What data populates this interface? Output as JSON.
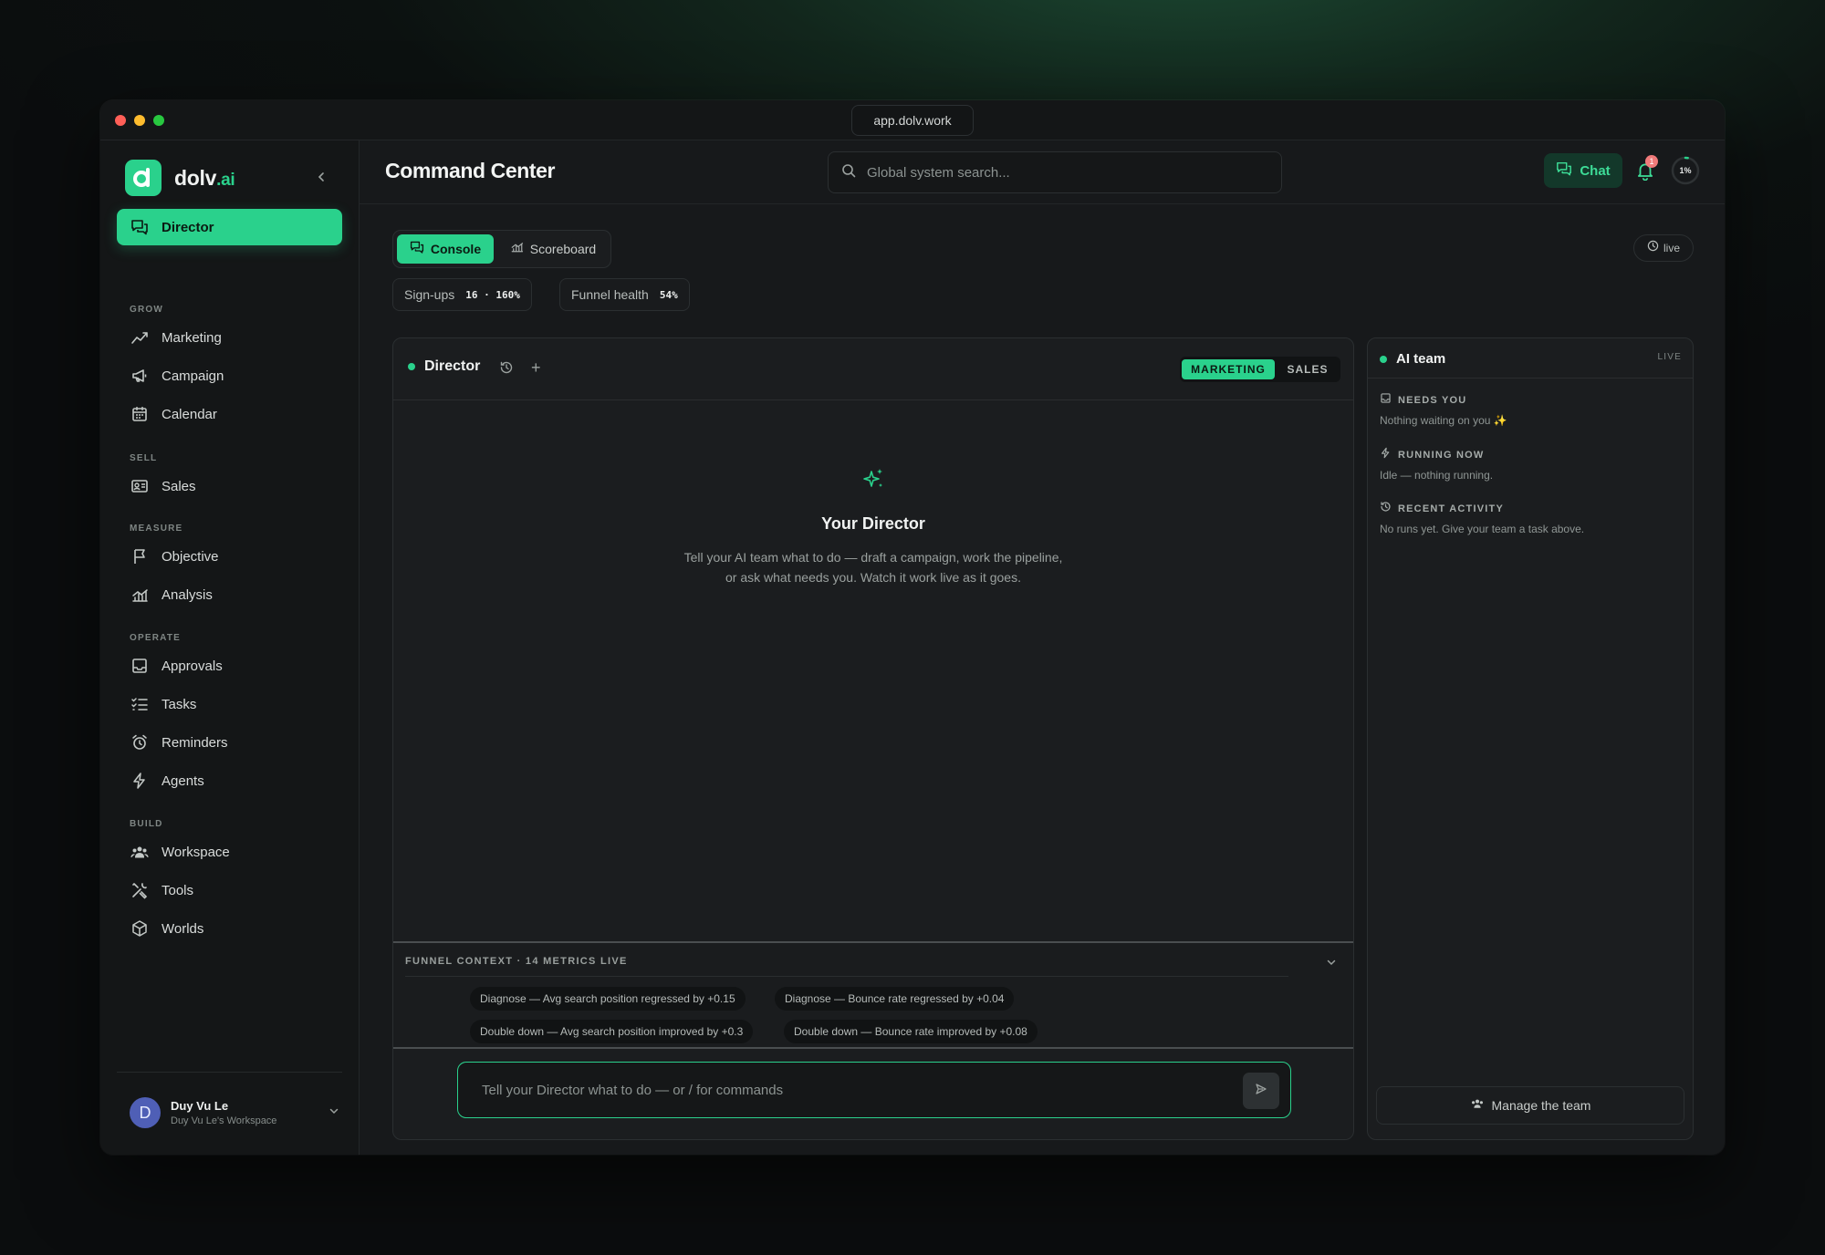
{
  "browser": {
    "url": "app.dolv.work"
  },
  "brand": {
    "name": "dolv",
    "suffix": ".ai",
    "accent": "#2ad18c"
  },
  "sidebar": {
    "active": {
      "label": "Director",
      "icon": "chat-bubbles-icon"
    },
    "sections": [
      {
        "label": "GROW",
        "items": [
          {
            "label": "Marketing",
            "icon": "trend-line-icon"
          },
          {
            "label": "Campaign",
            "icon": "megaphone-icon"
          },
          {
            "label": "Calendar",
            "icon": "calendar-icon"
          }
        ]
      },
      {
        "label": "SELL",
        "items": [
          {
            "label": "Sales",
            "icon": "contact-card-icon"
          }
        ]
      },
      {
        "label": "MEASURE",
        "items": [
          {
            "label": "Objective",
            "icon": "flag-icon"
          },
          {
            "label": "Analysis",
            "icon": "bar-chart-icon"
          }
        ]
      },
      {
        "label": "OPERATE",
        "items": [
          {
            "label": "Approvals",
            "icon": "inbox-icon"
          },
          {
            "label": "Tasks",
            "icon": "checklist-icon"
          },
          {
            "label": "Reminders",
            "icon": "alarm-clock-icon"
          },
          {
            "label": "Agents",
            "icon": "lightning-icon"
          }
        ]
      },
      {
        "label": "BUILD",
        "items": [
          {
            "label": "Workspace",
            "icon": "team-icon"
          },
          {
            "label": "Tools",
            "icon": "tools-icon"
          },
          {
            "label": "Worlds",
            "icon": "cube-icon"
          }
        ]
      }
    ],
    "user": {
      "initial": "D",
      "name": "Duy Vu Le",
      "workspace": "Duy Vu Le's Workspace"
    }
  },
  "header": {
    "title": "Command Center",
    "search_placeholder": "Global system search...",
    "chat_label": "Chat",
    "notification_count": "1",
    "progress_label": "1%",
    "progress_fraction": 0.01
  },
  "main": {
    "tabs": [
      {
        "label": "Console",
        "active": true
      },
      {
        "label": "Scoreboard",
        "active": false
      }
    ],
    "live_label": "live",
    "metrics": [
      {
        "label": "Sign-ups",
        "value": "16 · 160%"
      },
      {
        "label": "Funnel health",
        "value": "54%"
      }
    ]
  },
  "director": {
    "title": "Director",
    "modes": [
      {
        "label": "MARKETING",
        "active": true
      },
      {
        "label": "SALES",
        "active": false
      }
    ],
    "empty_title": "Your Director",
    "empty_text": "Tell your AI team what to do — draft a campaign, work the pipeline, or ask what needs you. Watch it work live as it goes.",
    "funnel": {
      "label": "FUNNEL CONTEXT · 14 METRICS LIVE",
      "chips": [
        "Diagnose — Avg search position regressed by +0.15",
        "Diagnose — Bounce rate regressed by +0.04",
        "Double down — Avg search position improved by +0.3",
        "Double down — Bounce rate improved by +0.08"
      ]
    },
    "composer_placeholder": "Tell your Director what to do — or / for commands"
  },
  "ai_team": {
    "title": "AI team",
    "live_label": "LIVE",
    "sections": [
      {
        "label": "NEEDS YOU",
        "text": "Nothing waiting on you ✨",
        "icon": "inbox-icon"
      },
      {
        "label": "RUNNING NOW",
        "text": "Idle — nothing running.",
        "icon": "lightning-icon"
      },
      {
        "label": "RECENT ACTIVITY",
        "text": "No runs yet. Give your team a task above.",
        "icon": "history-icon"
      }
    ],
    "manage_label": "Manage the team"
  }
}
